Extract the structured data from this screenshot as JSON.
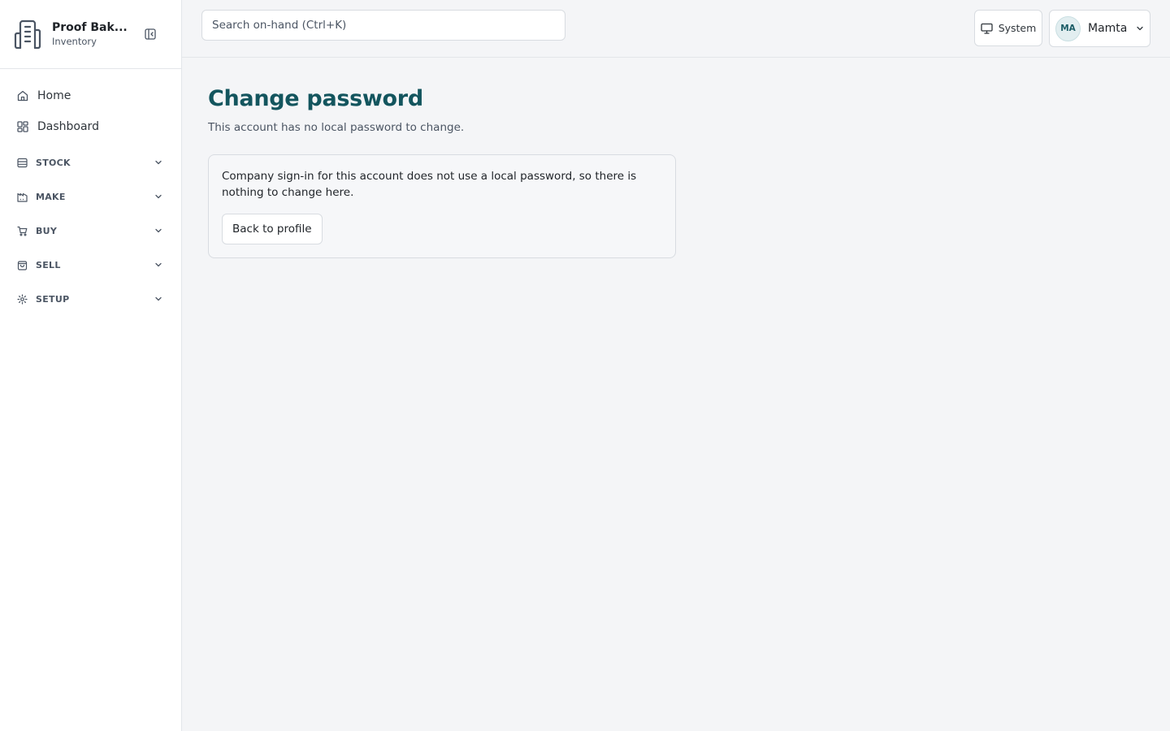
{
  "brand": {
    "name": "Proof Bak...",
    "subtitle": "Inventory",
    "logo_icon": "building-icon"
  },
  "sidebar": {
    "collapse_icon": "sidebar-collapse-icon",
    "items": [
      {
        "label": "Home",
        "icon": "home-icon"
      },
      {
        "label": "Dashboard",
        "icon": "dashboard-grid-icon"
      }
    ],
    "groups": [
      {
        "label": "STOCK",
        "icon": "database-icon"
      },
      {
        "label": "MAKE",
        "icon": "factory-icon"
      },
      {
        "label": "BUY",
        "icon": "cart-icon"
      },
      {
        "label": "SELL",
        "icon": "bag-icon"
      },
      {
        "label": "SETUP",
        "icon": "gear-icon"
      }
    ]
  },
  "header": {
    "search_placeholder": "Search on-hand (Ctrl+K)",
    "theme_label": "System",
    "theme_icon": "monitor-icon",
    "user_initials": "MA",
    "user_name": "Mamta"
  },
  "main": {
    "title": "Change password",
    "subtitle": "This account has no local password to change.",
    "card_text": "Company sign-in for this account does not use a local password, so there is nothing to change here.",
    "back_button": "Back to profile"
  },
  "colors": {
    "accent": "#13555e",
    "background": "#f4f5f7",
    "surface": "#ffffff",
    "border": "#d8dce1"
  }
}
